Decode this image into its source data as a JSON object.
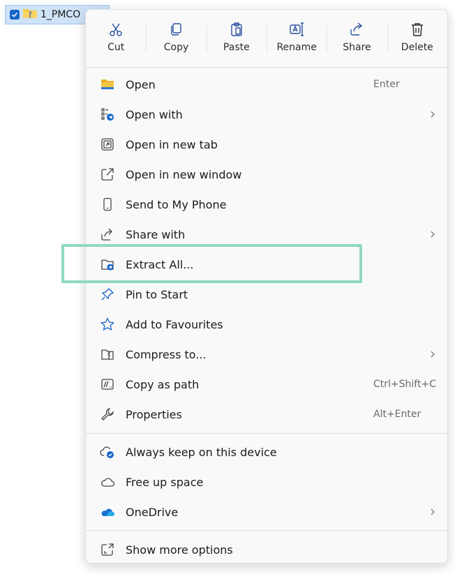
{
  "file": {
    "name": "1_PMCO"
  },
  "toolbar": [
    {
      "label": "Cut",
      "icon": "cut-icon"
    },
    {
      "label": "Copy",
      "icon": "copy-icon"
    },
    {
      "label": "Paste",
      "icon": "paste-icon"
    },
    {
      "label": "Rename",
      "icon": "rename-icon"
    },
    {
      "label": "Share",
      "icon": "share-icon"
    },
    {
      "label": "Delete",
      "icon": "delete-icon"
    }
  ],
  "items": [
    {
      "label": "Open",
      "shortcut": "Enter",
      "icon": "folder-icon"
    },
    {
      "label": "Open with",
      "icon": "open-with-icon",
      "submenu": true
    },
    {
      "label": "Open in new tab",
      "icon": "new-tab-icon"
    },
    {
      "label": "Open in new window",
      "icon": "new-window-icon"
    },
    {
      "label": "Send to My Phone",
      "icon": "phone-icon"
    },
    {
      "label": "Share with",
      "icon": "share-icon",
      "submenu": true
    },
    {
      "label": "Extract All...",
      "icon": "extract-icon"
    },
    {
      "label": "Pin to Start",
      "icon": "pin-icon"
    },
    {
      "label": "Add to Favourites",
      "icon": "star-icon"
    },
    {
      "label": "Compress to...",
      "icon": "compress-icon",
      "submenu": true
    },
    {
      "label": "Copy as path",
      "shortcut": "Ctrl+Shift+C",
      "icon": "path-icon"
    },
    {
      "label": "Properties",
      "shortcut": "Alt+Enter",
      "icon": "wrench-icon"
    },
    {
      "label": "Always keep on this device",
      "icon": "cloud-sync-icon"
    },
    {
      "label": "Free up space",
      "icon": "cloud-icon"
    },
    {
      "label": "OneDrive",
      "icon": "onedrive-icon",
      "submenu": true
    },
    {
      "label": "Show more options",
      "icon": "more-options-icon"
    }
  ],
  "colors": {
    "accent": "#1664c8",
    "highlight_border": "#8fd8c4",
    "folder_yellow": "#f5c542"
  }
}
